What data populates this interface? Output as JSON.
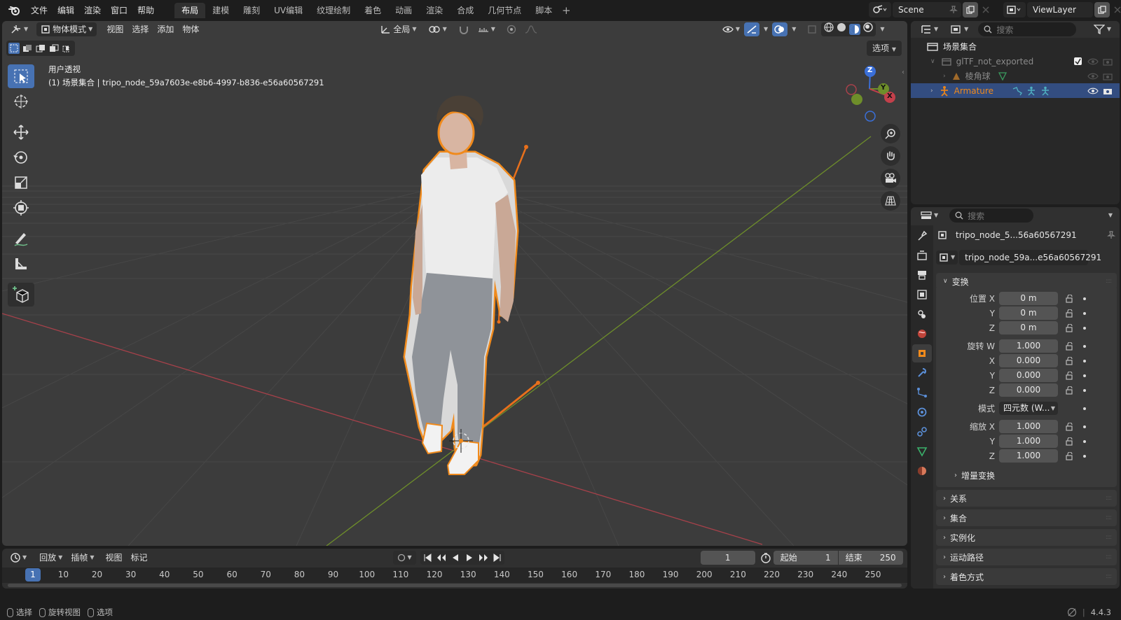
{
  "menu": [
    "文件",
    "编辑",
    "渲染",
    "窗口",
    "帮助"
  ],
  "workspaces": [
    "布局",
    "建模",
    "雕刻",
    "UV编辑",
    "纹理绘制",
    "着色",
    "动画",
    "渲染",
    "合成",
    "几何节点",
    "脚本"
  ],
  "active_workspace": "布局",
  "scene": {
    "name": "Scene",
    "view_layer": "ViewLayer"
  },
  "viewport": {
    "mode": "物体模式",
    "menus": [
      "视图",
      "选择",
      "添加",
      "物体"
    ],
    "transform_orientation": "全局",
    "options_label": "选项",
    "view_name": "用户透视",
    "object_path": "(1) 场景集合 | tripo_node_59a7603e-e8b6-4997-b836-e56a60567291",
    "gizmo": {
      "z": "Z",
      "y": "Y",
      "x": "X"
    }
  },
  "timeline": {
    "menus": [
      "回放",
      "插帧",
      "视图",
      "标记"
    ],
    "current_frame": "1",
    "start_label": "起始",
    "start": "1",
    "end_label": "结束",
    "end": "250",
    "ruler": [
      "1",
      "10",
      "20",
      "30",
      "40",
      "50",
      "60",
      "70",
      "80",
      "90",
      "100",
      "110",
      "120",
      "130",
      "140",
      "150",
      "160",
      "170",
      "180",
      "190",
      "200",
      "210",
      "220",
      "230",
      "240",
      "250"
    ]
  },
  "statusbar": {
    "select": "选择",
    "rotate": "旋转视图",
    "options": "选项",
    "version": "4.4.3"
  },
  "outliner": {
    "search_placeholder": "搜索",
    "root": "场景集合",
    "items": [
      {
        "label": "glTF_not_exported",
        "kind": "collection"
      },
      {
        "label": "棱角球",
        "kind": "mesh"
      },
      {
        "label": "Armature",
        "kind": "armature"
      }
    ]
  },
  "properties": {
    "search_placeholder": "搜索",
    "object_name_short": "tripo_node_5...56a60567291",
    "object_data_name": "tripo_node_59a...e56a60567291",
    "transform_panel": "变换",
    "location": [
      {
        "label": "位置 X",
        "value": "0 m"
      },
      {
        "label": "Y",
        "value": "0 m"
      },
      {
        "label": "Z",
        "value": "0 m"
      }
    ],
    "rotation": [
      {
        "label": "旋转 W",
        "value": "1.000"
      },
      {
        "label": "X",
        "value": "0.000"
      },
      {
        "label": "Y",
        "value": "0.000"
      },
      {
        "label": "Z",
        "value": "0.000"
      }
    ],
    "mode_label": "模式",
    "mode_value": "四元数 (W...",
    "scale": [
      {
        "label": "缩放 X",
        "value": "1.000"
      },
      {
        "label": "Y",
        "value": "1.000"
      },
      {
        "label": "Z",
        "value": "1.000"
      }
    ],
    "delta_transform": "增量变换",
    "panels": [
      "关系",
      "集合",
      "实例化",
      "运动路径",
      "着色方式"
    ]
  },
  "colors": {
    "accent": "#4772b3",
    "selection_outline": "#f08a1c",
    "x_axis": "#c3404b",
    "y_axis": "#6e8e2a",
    "z_axis": "#3a6fd8"
  }
}
